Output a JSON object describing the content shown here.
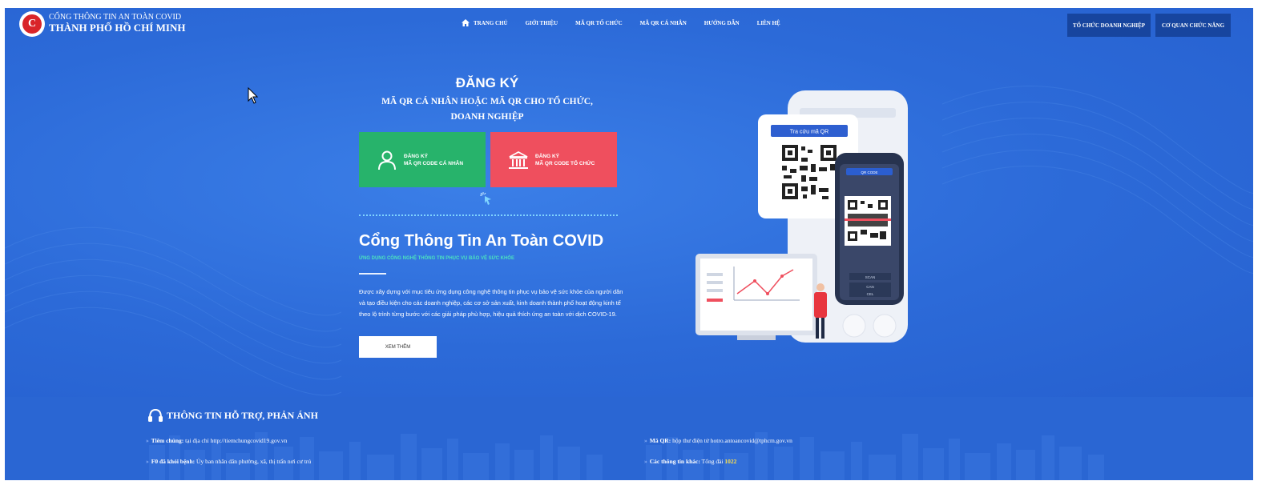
{
  "header": {
    "brand_line1": "CỔNG THÔNG TIN AN TOÀN COVID",
    "brand_line2": "THÀNH PHỐ HỒ CHÍ MINH",
    "nav": [
      "TRANG CHỦ",
      "GIỚI THIỆU",
      "MÃ QR TỔ CHỨC",
      "MÃ QR CÁ NHÂN",
      "HƯỚNG DẪN",
      "LIÊN HỆ"
    ],
    "btn_org": "TỔ CHỨC DOANH NGHIỆP",
    "btn_agency": "CƠ QUAN CHỨC NĂNG"
  },
  "register": {
    "title": "ĐĂNG KÝ",
    "subtitle": "MÃ QR CÁ NHÂN HOẶC MÃ QR CHO TỔ CHỨC, DOANH NGHIỆP",
    "personal": {
      "line1": "ĐĂNG KÝ",
      "line2": "MÃ QR CODE CÁ NHÂN"
    },
    "org": {
      "line1": "ĐĂNG KÝ",
      "line2": "MÃ QR CODE TỔ CHỨC"
    }
  },
  "portal": {
    "title": "Cổng Thông Tin An Toàn COVID",
    "tagline": "ỨNG DỤNG CÔNG NGHỆ THÔNG TIN PHỤC VỤ BẢO VỆ SỨC KHỎE",
    "description": "Được xây dựng với mục tiêu ứng dụng công nghệ thông tin phục vụ bảo vệ sức khỏe của người dân và tạo điều kiện cho các doanh nghiệp, các cơ sở sản xuất, kinh doanh thành phố hoạt động kinh tế theo lộ trình từng bước với các giải pháp phù hợp, hiệu quả thích ứng an toàn với dịch COVID-19.",
    "more_button": "XEM THÊM"
  },
  "illustration": {
    "lookup_label": "Tra cứu mã QR",
    "qr_code_label": "QR CODE",
    "scan_label": "SCAN",
    "can_label": "CAN",
    "cel_label": "CEL"
  },
  "footer": {
    "heading": "THÔNG TIN HỖ TRỢ, PHẢN ÁNH",
    "items": [
      {
        "label": "Tiêm chủng:",
        "text": " tại địa chỉ http://tiemchungcovid19.gov.vn"
      },
      {
        "label": "F0 đã khỏi bệnh:",
        "text": " Ủy ban nhân dân phường, xã, thị trấn nơi cư trú"
      },
      {
        "label": "Mã QR:",
        "text": " hộp thư điện tử hotro.antoancovid@tphcm.gov.vn"
      },
      {
        "label": "Các thông tin khác:",
        "text": " Tổng đài ",
        "highlight": "1022"
      }
    ]
  },
  "colors": {
    "background": "#2f6fdc",
    "personal_card": "#27b36b",
    "org_card": "#ef4f5e",
    "header_button": "#17459f",
    "highlight": "#ffe14a"
  }
}
